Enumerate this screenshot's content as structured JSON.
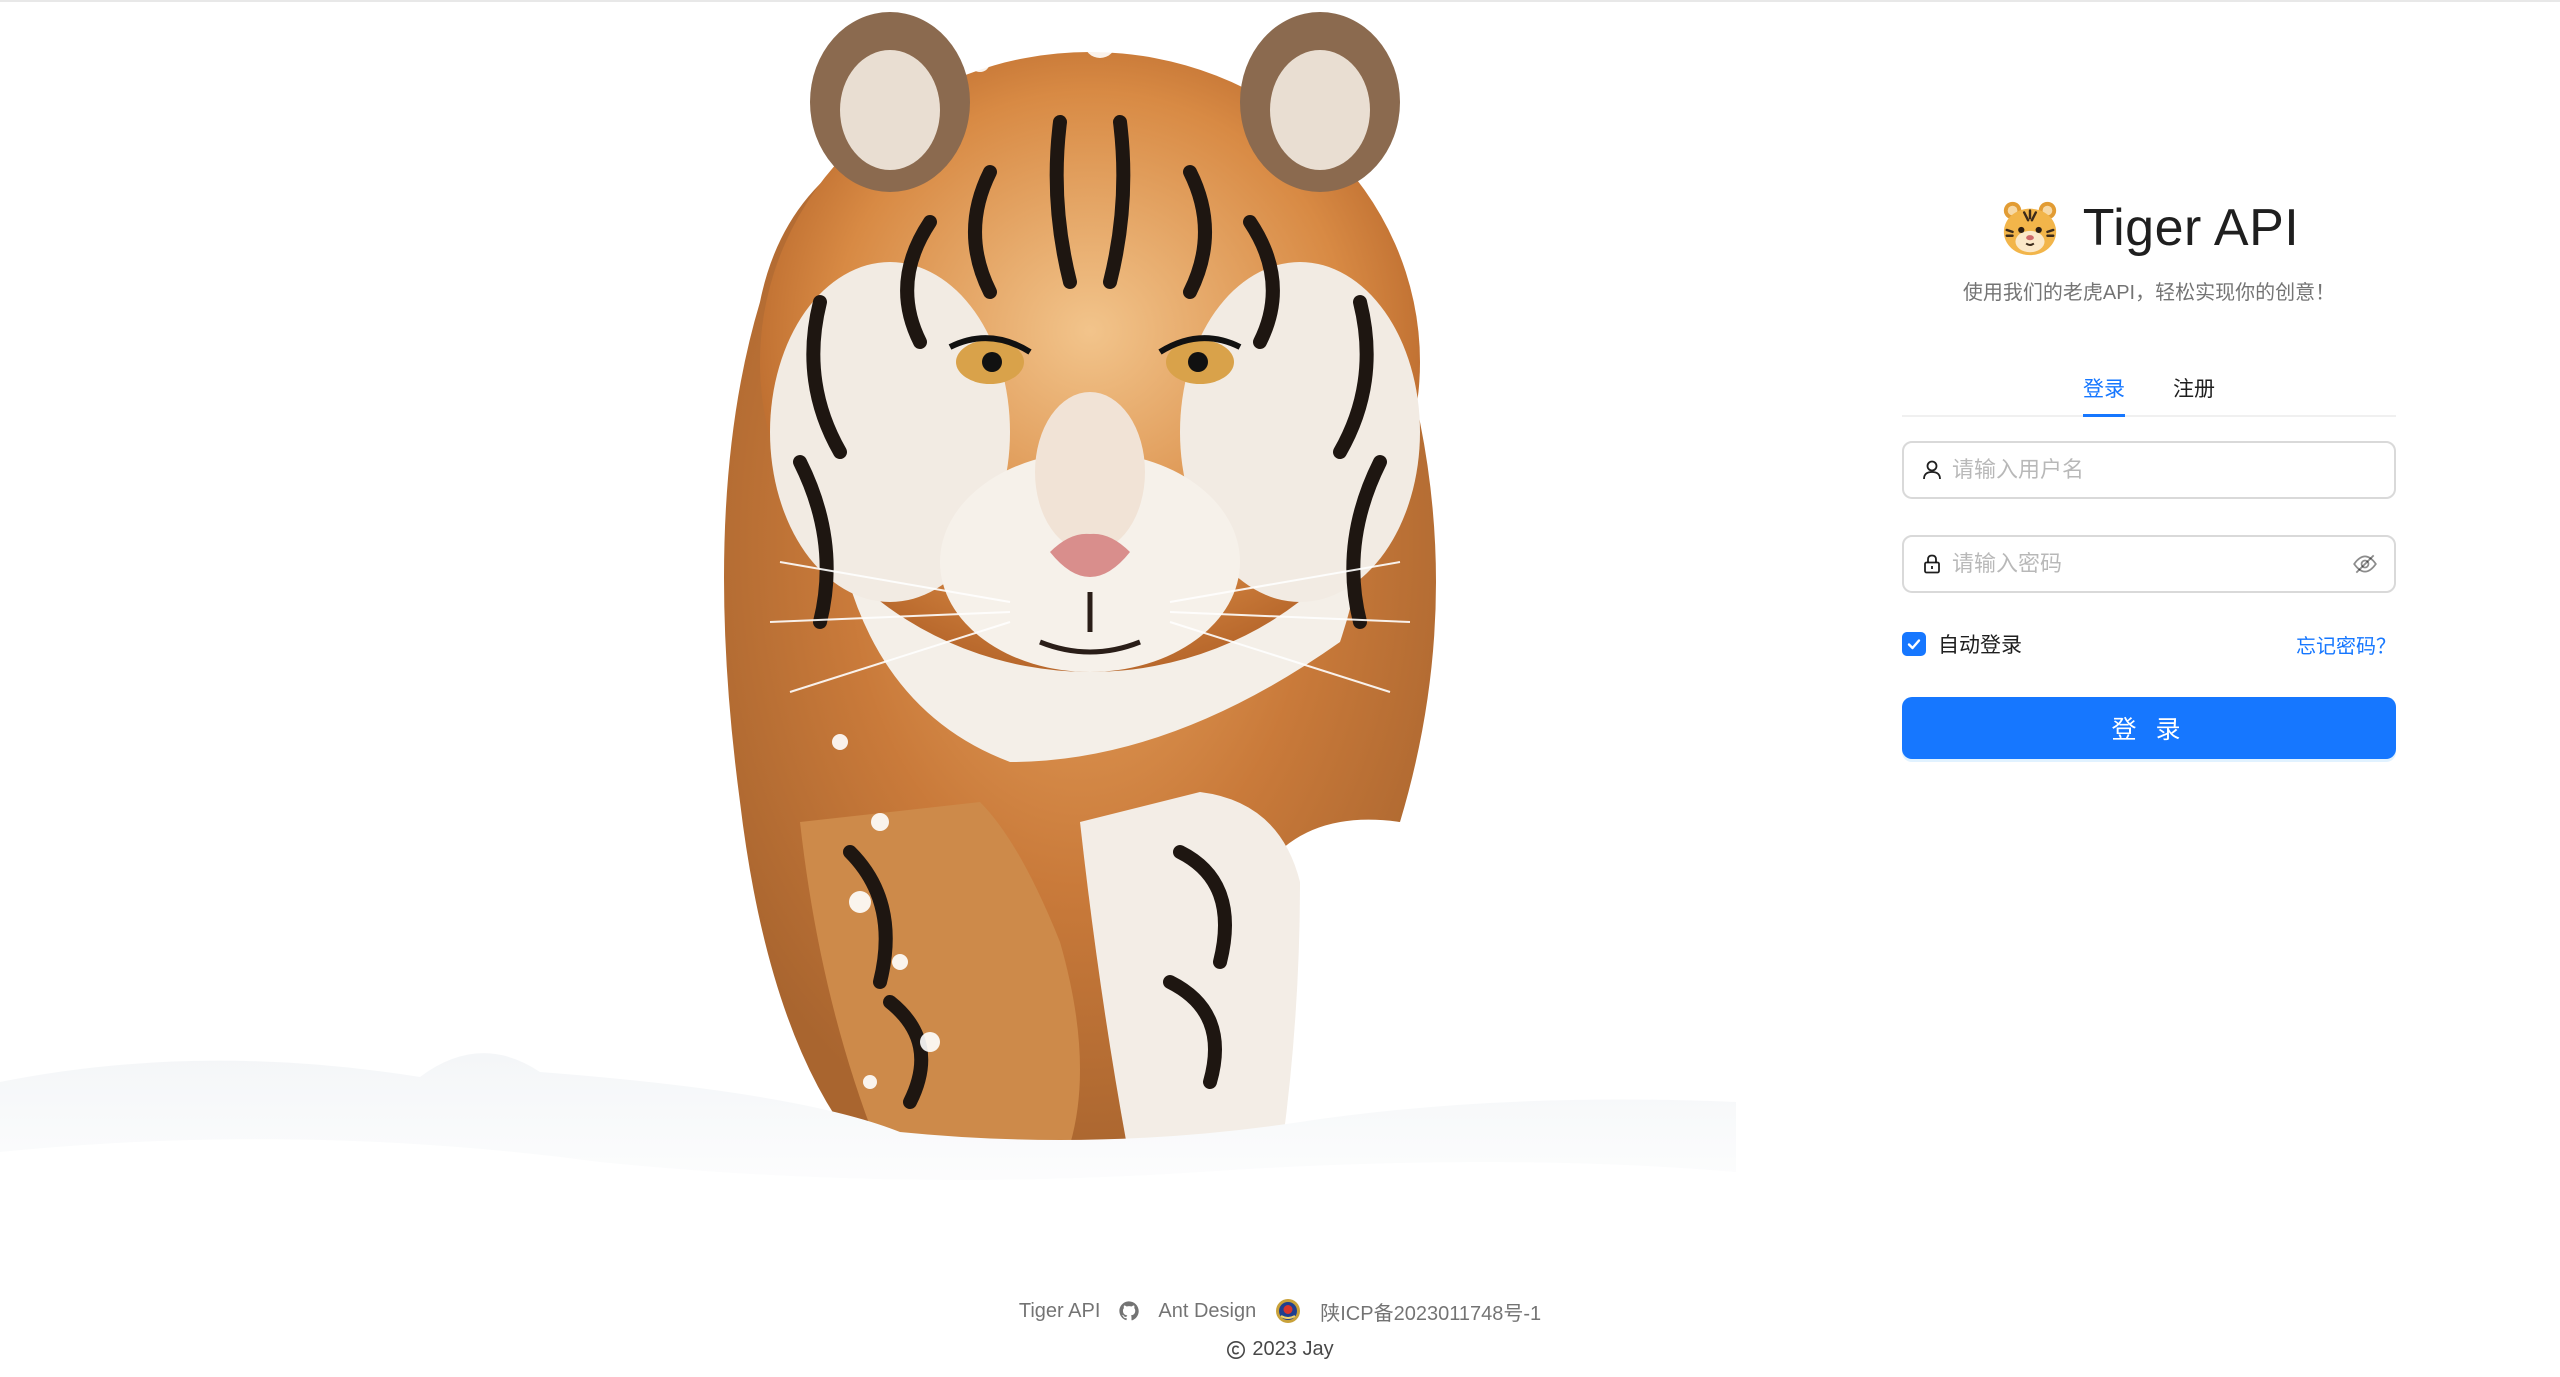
{
  "brand": {
    "title": "Tiger API",
    "subtitle": "使用我们的老虎API，轻松实现你的创意！",
    "logo_icon": "tiger-emoji-icon"
  },
  "tabs": [
    {
      "label": "登录",
      "active": true
    },
    {
      "label": "注册",
      "active": false
    }
  ],
  "form": {
    "username": {
      "placeholder": "请输入用户名",
      "value": "",
      "icon": "user-icon"
    },
    "password": {
      "placeholder": "请输入密码",
      "value": "",
      "icon": "lock-icon",
      "toggle_icon": "eye-invisible-icon"
    },
    "remember": {
      "label": "自动登录",
      "checked": true
    },
    "forgot_label": "忘记密码？",
    "submit_label": "登 录"
  },
  "footer": {
    "links": [
      {
        "label": "Tiger API"
      },
      {
        "label": "Ant Design",
        "icon": "github-icon"
      },
      {
        "label": "陕ICP备2023011748号-1",
        "icon": "police-badge-icon"
      }
    ],
    "copyright": "2023 Jay",
    "copyright_icon": "copyright-icon"
  },
  "colors": {
    "primary": "#1677ff",
    "text": "rgba(0,0,0,0.88)",
    "secondary_text": "rgba(0,0,0,0.55)",
    "border": "#d9d9d9"
  }
}
